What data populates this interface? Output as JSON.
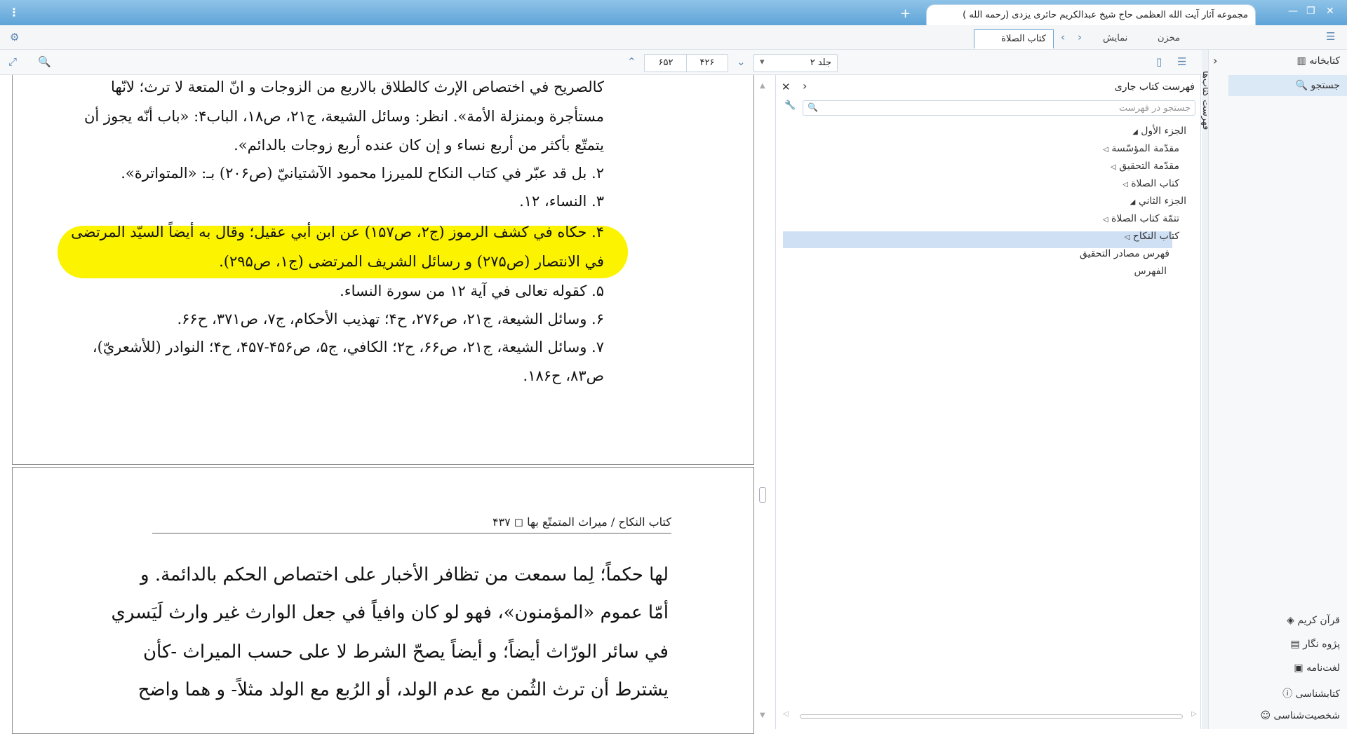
{
  "window": {
    "title_tab": "مجموعه آثار آیت الله العظمی حاج شیخ عبدالکریم حائری یزدی (رحمه الله )",
    "menu_icon": "kebab-menu-icon"
  },
  "toolbar": {
    "tabs": [
      {
        "label": "مخزن",
        "active": false
      },
      {
        "label": "نمایش",
        "active": false
      },
      {
        "label": "کتاب الصلاة",
        "active": true
      }
    ],
    "volume_select": "جلد ۲",
    "page_current": "۴۲۶",
    "page_total": "۶۵۲"
  },
  "reader": {
    "footnotes": [
      "کالصریح في اختصاص الإرث کالطلاق بالاربع من الزوجات و انّ المتعة لا ترث؛ لانّها",
      "مستأجرة وبمنزلة الأمة». انظر: وسائل الشیعة، ج۲۱، ص۱۸، الباب۴: «باب أنّه یجوز أن",
      "یتمتّع بأکثر من أربع نساء و إن کان عنده أربع زوجات بالدائم».",
      "۲. بل قد عبّر في کتاب النکاح للمیرزا محمود الآشتیانيّ (ص۲۰۶) بـ: «المتواترة».",
      "۳. النساء، ۱۲.",
      "۴. حکاه في کشف الرموز (ج۲، ص۱۵۷) عن ابن أبي عقیل؛ وقال به أیضاً السیّد المرتضی",
      "في الانتصار (ص۲۷۵) و رسائل الشریف المرتضی (ج۱، ص۲۹۵).",
      "۵. کقوله تعالی في آیة ۱۲ من سورة النساء.",
      "۶. وسائل الشیعة، ج۲۱، ص۲۷۶، ح۴؛ تهذیب الأحکام، ج۷، ص۳۷۱، ح۶۶.",
      "۷. وسائل الشیعة، ج۲۱، ص۶۶، ح۲؛ الکافي، ج۵، ص۴۵۶-۴۵۷، ح۴؛ النوادر (للأشعريّ)،",
      "ص۸۳، ح۱۸۶."
    ],
    "running_header": "کتاب النکاح / میراث المتمتّع بها ◻ ۴۳۷",
    "body": [
      "لها حکماً؛ لِما سمعت من تظافر الأخبار علی اختصاص الحکم بالدائمة. و",
      "أمّا عموم «المؤمنون»، فهو لو کان وافیاً في جعل الوارث غیر وارث لَیَسري",
      "في سائر الورّاث أیضاً؛ و أیضاً یصحّ الشرط لا علی حسب المیراث -کأن",
      "یشترط أن ترث الثُمن مع عدم الولد، أو الرُبع مع الولد مثلاً- و هما واضح"
    ]
  },
  "toc": {
    "title": "فهرست کتاب جاری",
    "search_placeholder": "جستجو در فهرست",
    "items": [
      {
        "label": "الجزء الأول",
        "level": 0,
        "expanded": true
      },
      {
        "label": "مقدّمة المؤسّسة",
        "level": 1
      },
      {
        "label": "مقدّمة التحقیق",
        "level": 1
      },
      {
        "label": "کتاب الصلاة",
        "level": 1
      },
      {
        "label": "الجزء الثاني",
        "level": 0,
        "expanded": true
      },
      {
        "label": "تتمّة کتاب الصلاة",
        "level": 1
      },
      {
        "label": "کتاب النکاح",
        "level": 1,
        "selected": true
      },
      {
        "label": "فهرس مصادر التحقیق",
        "level": 0
      },
      {
        "label": "الفهرس",
        "level": 0
      }
    ]
  },
  "sidebar": {
    "vertical_tab": "فهرست کتاب‌ها",
    "top": [
      {
        "label": "کتابخانه",
        "icon": "library-icon"
      },
      {
        "label": "جستجو",
        "icon": "search-icon"
      }
    ],
    "bottom": [
      {
        "label": "قرآن کریم",
        "icon": "quran-icon"
      },
      {
        "label": "پژوه نگار",
        "icon": "notebook-icon"
      },
      {
        "label": "لغت‌نامه",
        "icon": "dictionary-icon"
      },
      {
        "label": "کتابشناسی",
        "icon": "info-icon"
      },
      {
        "label": "شخصیت‌شناسی",
        "icon": "person-icon"
      }
    ]
  },
  "colors": {
    "highlight": "#fbf300",
    "accent": "#5ea4d8",
    "selection": "#cfe0f5"
  }
}
